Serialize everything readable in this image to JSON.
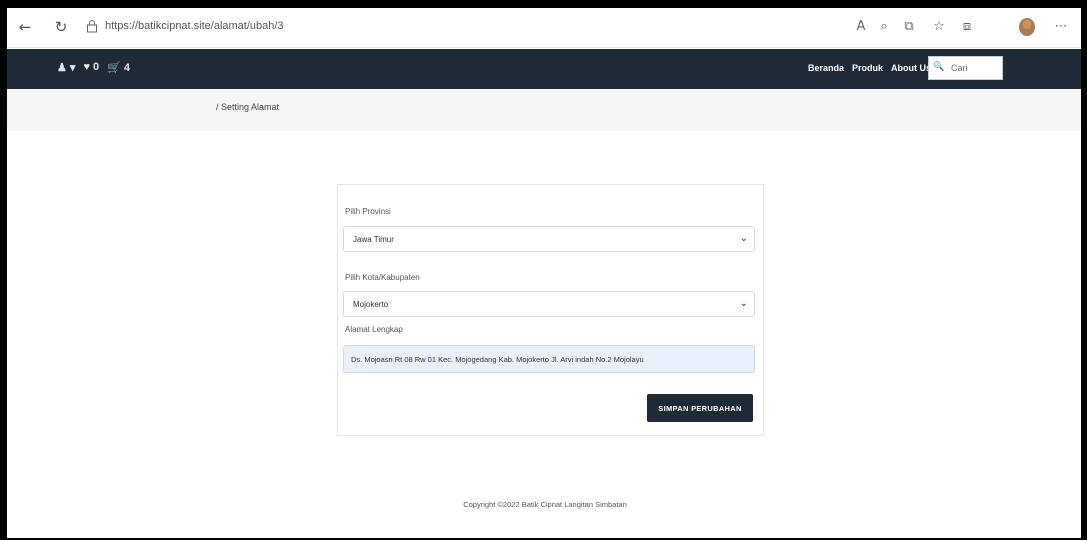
{
  "browser": {
    "url": "https://batikcipnat.site/alamat/ubah/3",
    "back_icon": "back-arrow-icon",
    "reload_icon": "reload-icon"
  },
  "navbar": {
    "left_items": [
      "♟ ▾",
      "♥ 0",
      "🛒 4"
    ],
    "links": [
      "Beranda",
      "Produk",
      "About Us"
    ],
    "search_placeholder": "Cari"
  },
  "breadcrumb": "/ Setting Alamat",
  "form": {
    "province_label": "Pilih Provinsi",
    "province_value": "Jawa Timur",
    "city_label": "Pilih Kota/Kabupaten",
    "city_value": "Mojokerto",
    "address_label": "Alamat Lengkap",
    "address_value": "Ds. Mojoasri Rt 08 Rw 01 Kec. Mojogedang Kab. Mojokerto Jl. Arvi indah No.2 Mojolayu",
    "save_label": "SIMPAN PERUBAHAN"
  },
  "footer": "Copyright ©2022 Batik Cipnat Langitan Simbatan",
  "colors": {
    "navbar": "#1f2a37",
    "accent": "#1f2a37",
    "input_fill": "#e9f0fb"
  }
}
